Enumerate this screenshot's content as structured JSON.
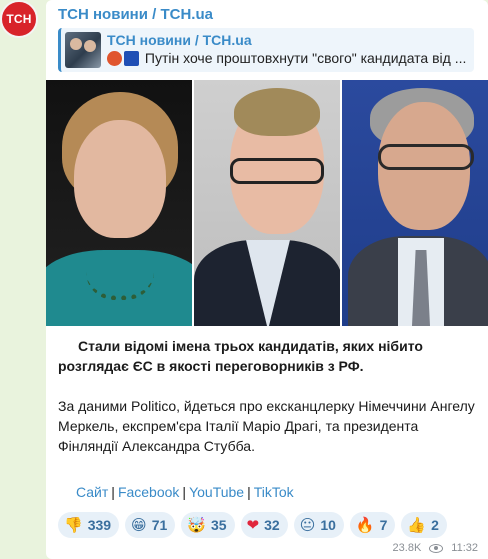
{
  "channel": {
    "avatar_text": "ТСН",
    "name": "ТСН новини / TCH.ua"
  },
  "reply": {
    "title": "ТСН новини / TCH.ua",
    "text": "Путін хоче проштовхнути \"свого\" кандидата від ..."
  },
  "post": {
    "lead": "Стали відомі імена трьох кандидатів, яких нібито розглядає ЄС в якості переговорників з РФ.",
    "body": "За даними Politico, йдеться про ексканцлерку Німеччини Ангелу Меркель, експрем'єра Італії Маріо Драгі, та президента Фінляндії Александра Стубба."
  },
  "links": [
    "Сайт",
    "Facebook",
    "YouTube",
    "TikTok"
  ],
  "reactions": [
    {
      "emoji": "👎",
      "count": "339"
    },
    {
      "emoji": "😁",
      "count": "71"
    },
    {
      "emoji": "🤯",
      "count": "35"
    },
    {
      "emoji": "❤",
      "count": "32"
    },
    {
      "emoji": "😐",
      "count": "10"
    },
    {
      "emoji": "🔥",
      "count": "7"
    },
    {
      "emoji": "👍",
      "count": "2"
    }
  ],
  "meta": {
    "views": "23.8K",
    "time": "11:32"
  },
  "colors": {
    "accent": "#3a8bc8",
    "background": "#e9f3dd",
    "avatar": "#d8232a"
  }
}
